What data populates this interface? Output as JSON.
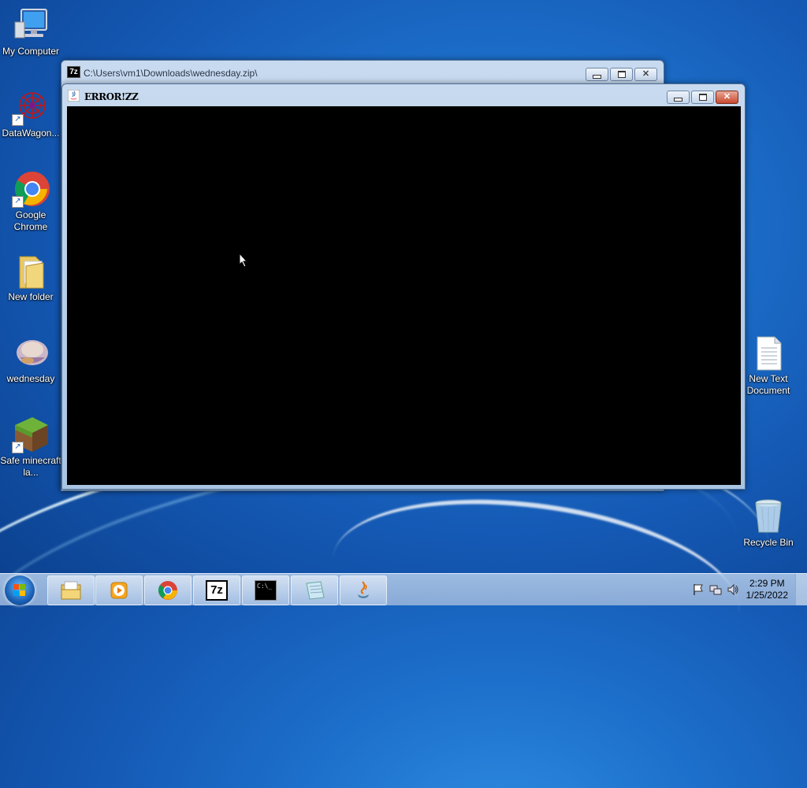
{
  "desktop": {
    "icons": [
      {
        "label": "My Computer"
      },
      {
        "label": "DataWagon..."
      },
      {
        "label": "Google Chrome"
      },
      {
        "label": "New folder"
      },
      {
        "label": "wednesday"
      },
      {
        "label": "Safe minecraft la..."
      },
      {
        "label": "New Text Document"
      },
      {
        "label": "Recycle Bin"
      }
    ]
  },
  "window_7zip": {
    "title": "C:\\Users\\vm1\\Downloads\\wednesday.zip\\",
    "icon_text": "7z"
  },
  "window_java": {
    "title": "ERROR!ZZ"
  },
  "taskbar": {
    "apps": [
      {
        "name": "Windows Explorer",
        "icon": "explorer-icon"
      },
      {
        "name": "Windows Media Player",
        "icon": "media-player-icon"
      },
      {
        "name": "Google Chrome",
        "icon": "chrome-icon"
      },
      {
        "name": "7-Zip",
        "icon": "7zip-icon",
        "text": "7z"
      },
      {
        "name": "Command Prompt",
        "icon": "cmd-icon",
        "text": "C:\\_"
      },
      {
        "name": "Notepad",
        "icon": "notepad-icon"
      },
      {
        "name": "Java",
        "icon": "java-icon"
      }
    ],
    "time": "2:29 PM",
    "date": "1/25/2022"
  }
}
